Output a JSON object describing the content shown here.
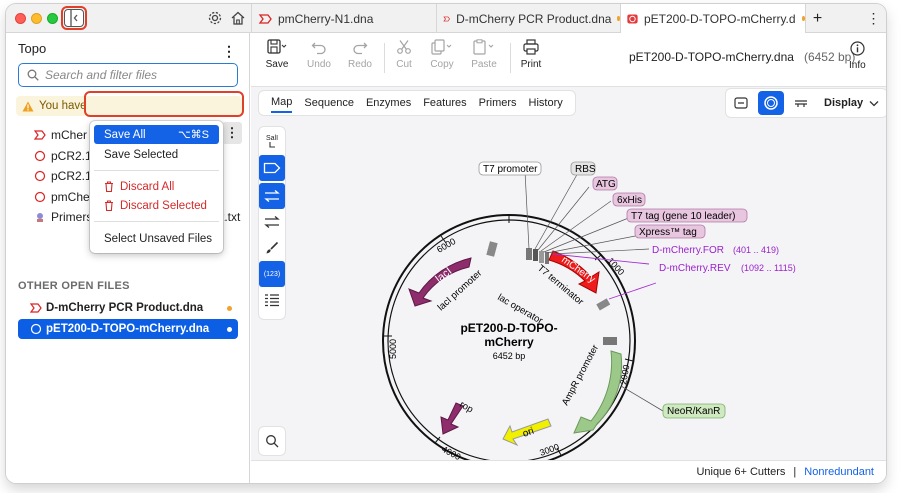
{
  "tabs": [
    {
      "label": "pmCherry-N1.dna",
      "unsaved": false
    },
    {
      "label": "D-mCherry PCR Product.dna",
      "unsaved": true
    },
    {
      "label": "pET200-D-TOPO-mCherry.d",
      "unsaved": true
    }
  ],
  "sidebar": {
    "title": "Topo",
    "search_placeholder": "Search and filter files",
    "warning_text": "You have",
    "files": [
      {
        "label": "mCher"
      },
      {
        "label": "pCR2.1-"
      },
      {
        "label": "pCR2.1-"
      },
      {
        "label": "pmChe"
      },
      {
        "label": "Primers",
        "suffix": "t.txt"
      }
    ],
    "other_open_label": "OTHER OPEN FILES",
    "open_files": [
      {
        "label": "D-mCherry PCR Product.dna"
      },
      {
        "label": "pET200-D-TOPO-mCherry.dna"
      }
    ]
  },
  "context_menu": {
    "items": [
      {
        "label": "Save All",
        "shortcut": "⌥⌘S"
      },
      {
        "label": "Save Selected"
      },
      {
        "label": "Discard All"
      },
      {
        "label": "Discard Selected"
      },
      {
        "label": "Select Unsaved Files"
      }
    ]
  },
  "toolbar": {
    "save": "Save",
    "undo": "Undo",
    "redo": "Redo",
    "cut": "Cut",
    "copy": "Copy",
    "paste": "Paste",
    "print": "Print",
    "info": "Info"
  },
  "document": {
    "name": "pET200-D-TOPO-mCherry.dna",
    "size": "(6452 bp)"
  },
  "view_tabs": [
    "Map",
    "Sequence",
    "Enzymes",
    "Features",
    "Primers",
    "History"
  ],
  "display_label": "Display",
  "map": {
    "name_line1": "pET200-D-TOPO-",
    "name_line2": "mCherry",
    "length": "6452 bp",
    "ticks": [
      "1000",
      "2000",
      "3000",
      "4000",
      "5000",
      "6000"
    ],
    "restriction_site": "SalI",
    "labels": {
      "t7_promoter": "T7 promoter",
      "rbs": "RBS",
      "atg": "ATG",
      "his": "6xHis",
      "t7tag": "T7 tag (gene 10 leader)",
      "xpress": "Xpress™ tag",
      "for_primer": "D-mCherry.FOR",
      "for_range": "(401 .. 419)",
      "rev_primer": "D-mCherry.REV",
      "rev_range": "(1092 .. 1115)",
      "mcherry": "mCherry",
      "t7_terminator": "T7 terminator",
      "laci": "lacI",
      "laci_promoter": "lacI promoter",
      "lac_operator": "lac operator",
      "ampr_promoter": "AmpR promoter",
      "neor": "NeoR/KanR",
      "ori": "ori",
      "rop": "rop"
    },
    "tool_count": "(123)"
  },
  "status": {
    "cutters": "Unique 6+ Cutters",
    "mode": "Nonredundant"
  }
}
